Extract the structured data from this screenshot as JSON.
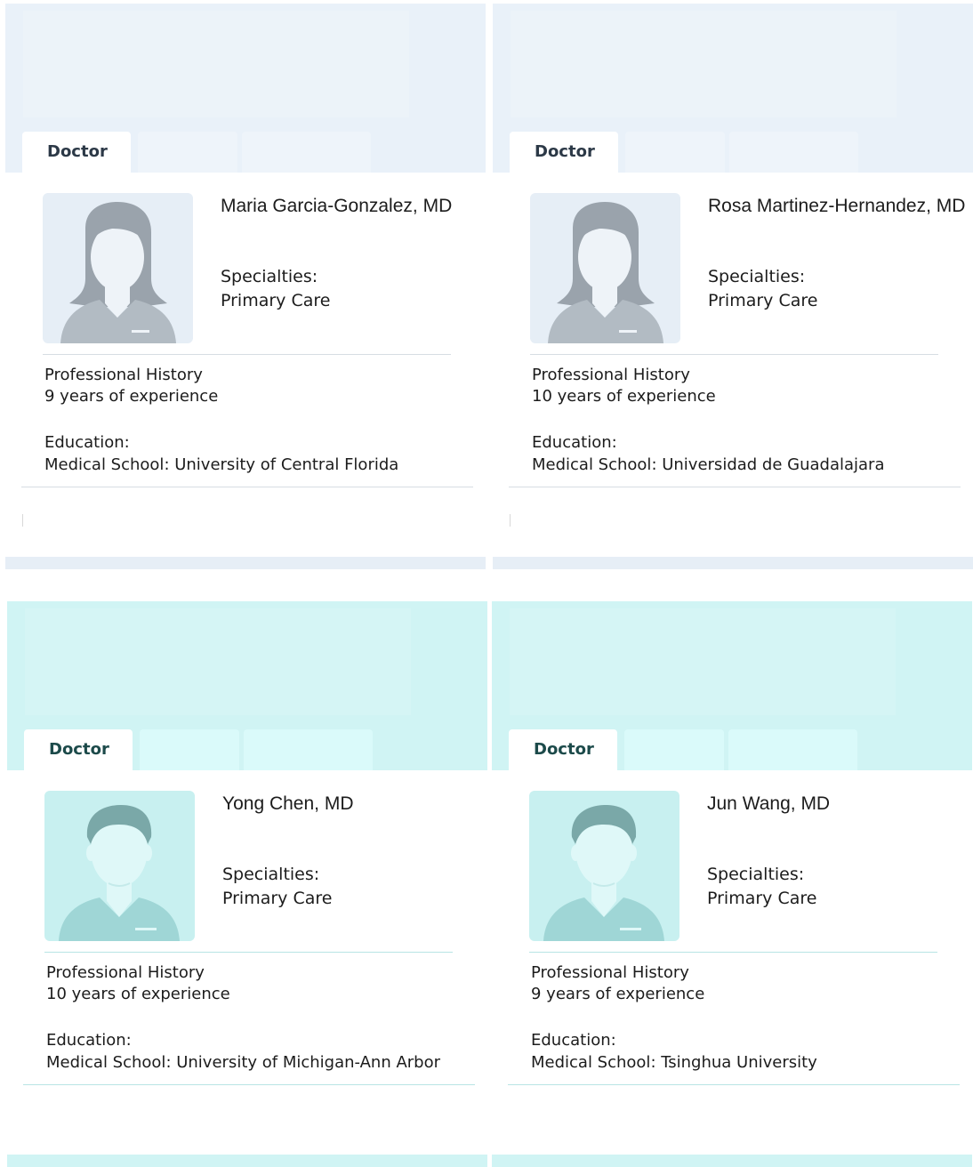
{
  "cards": [
    {
      "tab_label": "Doctor",
      "name": "Maria Garcia-Gonzalez, MD",
      "specialties_label": "Specialties:",
      "specialties": "Primary Care",
      "history_label": "Professional History",
      "experience": "9 years of experience",
      "education_label": "Education:",
      "education": "Medical School: University of Central Florida",
      "avatar": "female-doctor-avatar-icon",
      "theme": "#e9f1f9"
    },
    {
      "tab_label": "Doctor",
      "name": "Rosa Martinez-Hernandez, MD",
      "specialties_label": "Specialties:",
      "specialties": "Primary Care",
      "history_label": "Professional History",
      "experience": "10 years of experience",
      "education_label": "Education:",
      "education": "Medical School: Universidad de Guadalajara",
      "avatar": "female-doctor-avatar-icon",
      "theme": "#e9f1f9"
    },
    {
      "tab_label": "Doctor",
      "name": "Yong Chen, MD",
      "specialties_label": "Specialties:",
      "specialties": "Primary Care",
      "history_label": "Professional History",
      "experience": "10 years of experience",
      "education_label": "Education:",
      "education": "Medical School: University of Michigan-Ann Arbor",
      "avatar": "male-doctor-avatar-icon",
      "theme": "#d0f4f4"
    },
    {
      "tab_label": "Doctor",
      "name": "Jun Wang, MD",
      "specialties_label": "Specialties:",
      "specialties": "Primary Care",
      "history_label": "Professional History",
      "experience": "9 years of experience",
      "education_label": "Education:",
      "education": "Medical School: Tsinghua University",
      "avatar": "male-doctor-avatar-icon",
      "theme": "#d0f4f4"
    }
  ]
}
